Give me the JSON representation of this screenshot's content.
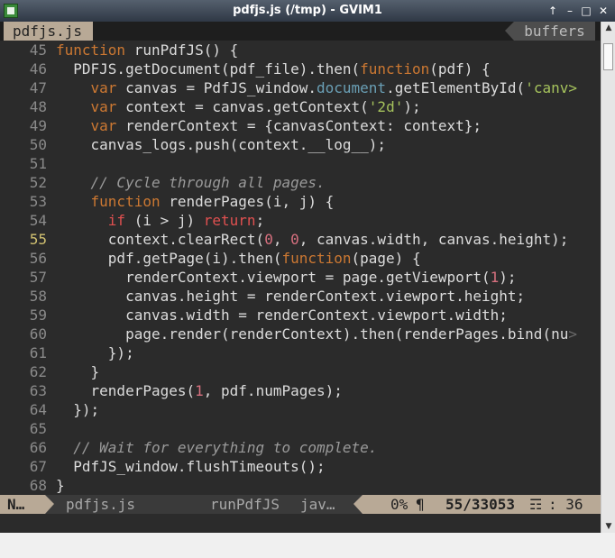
{
  "window": {
    "title": "pdfjs.js (/tmp) - GVIM1",
    "controls": {
      "up": "↑",
      "minimize": "–",
      "maximize": "□",
      "close": "✕"
    }
  },
  "tabline": {
    "active_tab": "pdfjs.js",
    "buffers_label": "buffers"
  },
  "colors": {
    "bg": "#2b2b2b",
    "keyword": "#cc7832",
    "string": "#a5c25c",
    "number": "#d7707f",
    "comment": "#9a9a9a",
    "accent": "#b8a996"
  },
  "lines": [
    {
      "num": "45",
      "text": "function runPdfJS() {"
    },
    {
      "num": "46",
      "text": "  PDFJS.getDocument(pdf_file).then(function(pdf) {"
    },
    {
      "num": "47",
      "text": "    var canvas = PdfJS_window.document.getElementById('canv>"
    },
    {
      "num": "48",
      "text": "    var context = canvas.getContext('2d');"
    },
    {
      "num": "49",
      "text": "    var renderContext = {canvasContext: context};"
    },
    {
      "num": "50",
      "text": "    canvas_logs.push(context.__log__);"
    },
    {
      "num": "51",
      "text": ""
    },
    {
      "num": "52",
      "text": "    // Cycle through all pages."
    },
    {
      "num": "53",
      "text": "    function renderPages(i, j) {"
    },
    {
      "num": "54",
      "text": "      if (i > j) return;"
    },
    {
      "num": "55",
      "text": "      context.clearRect(0, 0, canvas.width, canvas.height);"
    },
    {
      "num": "56",
      "text": "      pdf.getPage(i).then(function(page) {"
    },
    {
      "num": "57",
      "text": "        renderContext.viewport = page.getViewport(1);"
    },
    {
      "num": "58",
      "text": "        canvas.height = renderContext.viewport.height;"
    },
    {
      "num": "59",
      "text": "        canvas.width = renderContext.viewport.width;"
    },
    {
      "num": "60",
      "text": "        page.render(renderContext).then(renderPages.bind(nu>"
    },
    {
      "num": "61",
      "text": "      });"
    },
    {
      "num": "62",
      "text": "    }"
    },
    {
      "num": "63",
      "text": "    renderPages(1, pdf.numPages);"
    },
    {
      "num": "64",
      "text": "  });"
    },
    {
      "num": "65",
      "text": ""
    },
    {
      "num": "66",
      "text": "  // Wait for everything to complete."
    },
    {
      "num": "67",
      "text": "  PdfJS_window.flushTimeouts();"
    },
    {
      "num": "68",
      "text": "}"
    }
  ],
  "statusline": {
    "mode": "N…",
    "filename": "pdfjs.js",
    "function": "runPdfJS",
    "filetype": "jav…",
    "percent": "0%",
    "pilcrow": "¶",
    "position": "55/33053",
    "column_icon": "☶",
    "column": ": 36"
  },
  "scrollbar": {
    "up": "▲",
    "down": "▼"
  }
}
